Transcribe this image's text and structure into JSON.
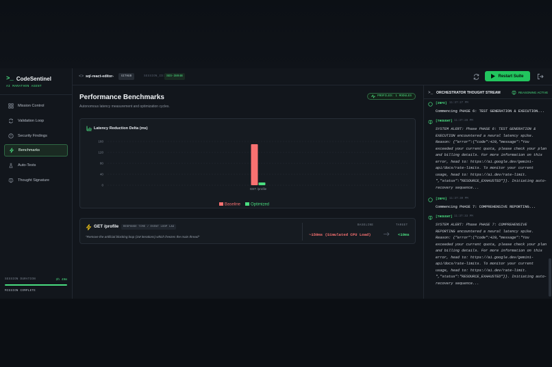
{
  "brand": {
    "name": "CodeSentinel",
    "subtitle": "AI MARATHON AGENT",
    "logo_glyph": ">_"
  },
  "sidebar": {
    "items": [
      {
        "label": "Mission Control",
        "icon": "grid-icon",
        "active": false
      },
      {
        "label": "Validation Loop",
        "icon": "loop-icon",
        "active": false
      },
      {
        "label": "Security Findings",
        "icon": "shield-icon",
        "active": false
      },
      {
        "label": "Benchmarks",
        "icon": "lightning-icon",
        "active": true
      },
      {
        "label": "Auto-Tests",
        "icon": "flask-icon",
        "active": false
      },
      {
        "label": "Thought Signature",
        "icon": "brain-icon",
        "active": false
      }
    ],
    "session": {
      "label": "SESSION DURATION",
      "value": "2h 49m",
      "progress": 1.0,
      "status": "MISSION COMPLETE"
    }
  },
  "topbar": {
    "project": "sql-react-editor-",
    "badge": "GITHUB",
    "session_label": "SESSION_ID:",
    "session_id": "SES-3894B",
    "restart_label": "Restart Suite"
  },
  "main": {
    "title": "Performance Benchmarks",
    "subtitle": "Autonomous latency measurement and optimization cycles.",
    "profiled": "PROFILED: 1 MODULES",
    "chart_title": "Latency Reduction Delta (ms)"
  },
  "chart_data": {
    "type": "bar",
    "title": "Latency Reduction Delta (ms)",
    "categories": [
      "GET /profile"
    ],
    "series": [
      {
        "name": "Baseline",
        "values": [
          150
        ],
        "color": "#f87171"
      },
      {
        "name": "Optimized",
        "values": [
          10
        ],
        "color": "#4ade80"
      }
    ],
    "yticks": [
      0,
      40,
      80,
      120,
      160
    ],
    "ylim": [
      0,
      160
    ],
    "grid": true,
    "legend": "bottom-center"
  },
  "endpoint": {
    "method": "GET /profile",
    "tag": "RESPONSE TIME / EVENT LOOP LAG",
    "description": "\"Remove the artificial blocking loop (1M iterations) which freezes the main thread\"",
    "baseline_label": "BASELINE",
    "baseline_value": "~150ms (Simulated CPU Load)",
    "target_label": "TARGET",
    "target_value": "<10ms"
  },
  "stream": {
    "title": "ORCHESTRATOR THOUGHT STREAM",
    "status": "REASONING ACTIVE",
    "logs": [
      {
        "tag": "[INFO]",
        "time": "11:37:27 PM",
        "kind": "info",
        "message": "Commencing PHASE 6: TEST GENERATION & EXECUTION..."
      },
      {
        "tag": "[THOUGHT]",
        "time": "11:37:28 PM",
        "kind": "thought",
        "message": "SYSTEM ALERT: Phase PHASE 6: TEST GENERATION & EXECUTION encountered a neural latency spike. Reason: {\"error\":{\"code\":429,\"message\":\"You exceeded your current quota, please check your plan and billing details. For more information on this error, head to: https://ai.google.dev/gemini-api/docs/rate-limits. To monitor your current usage, head to: https://ai.dev/rate-limit. \",\"status\":\"RESOURCE_EXHAUSTED\"}}. Initiating auto-recovery sequence..."
      },
      {
        "tag": "[INFO]",
        "time": "11:37:30 PM",
        "kind": "info",
        "message": "Commencing PHASE 7: COMPREHENSIVE REPORTING..."
      },
      {
        "tag": "[THOUGHT]",
        "time": "11:37:33 PM",
        "kind": "thought",
        "message": "SYSTEM ALERT: Phase PHASE 7: COMPREHENSIVE REPORTING encountered a neural latency spike. Reason: {\"error\":{\"code\":429,\"message\":\"You exceeded your current quota, please check your plan and billing details. For more information on this error, head to: https://ai.google.dev/gemini-api/docs/rate-limits. To monitor your current usage, head to: https://ai.dev/rate-limit. \",\"status\":\"RESOURCE_EXHAUSTED\"}}. Initiating auto-recovery sequence..."
      }
    ]
  },
  "colors": {
    "accent": "#22c55e",
    "accent_text": "#4ade80",
    "danger": "#f87171",
    "bg": "#12161c"
  }
}
